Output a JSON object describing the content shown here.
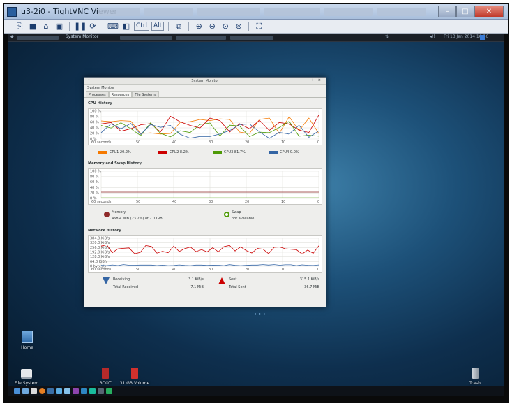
{
  "viewer": {
    "title": "u3-2i0 - TightVNC Viewer",
    "toolbar_alt": "Alt",
    "toolbar_ctrl": "Ctrl"
  },
  "remote": {
    "taskbar_window": "System Monitor",
    "clock": "Fri 13 Jan 2014 16:36"
  },
  "monitor": {
    "window_title": "System Monitor",
    "menu_label": "System Monitor",
    "tabs": [
      "Processes",
      "Resources",
      "File Systems"
    ],
    "active_tab": "Resources",
    "cpu": {
      "title": "CPU History",
      "y_labels": [
        "100 %",
        "80 %",
        "60 %",
        "40 %",
        "20 %",
        "0 %"
      ],
      "x_labels": [
        "60 seconds",
        "50",
        "40",
        "30",
        "20",
        "10",
        "0"
      ],
      "legend": [
        {
          "label": "CPU1 20.2%",
          "color": "#f57900"
        },
        {
          "label": "CPU2 8.2%",
          "color": "#cc0000"
        },
        {
          "label": "CPU3 81.7%",
          "color": "#4e9a06"
        },
        {
          "label": "CPU4 0.0%",
          "color": "#3465a4"
        }
      ]
    },
    "mem": {
      "title": "Memory and Swap History",
      "y_labels": [
        "100 %",
        "80 %",
        "60 %",
        "40 %",
        "20 %",
        "0 %"
      ],
      "x_labels": [
        "60 seconds",
        "50",
        "40",
        "30",
        "20",
        "10",
        "0"
      ],
      "memory_label": "Memory",
      "memory_value": "468.4 MiB (23.2%) of 2.0 GiB",
      "swap_label": "Swap",
      "swap_value": "not available",
      "memory_color": "#8f2a2a",
      "swap_color": "#4e9a06"
    },
    "net": {
      "title": "Network History",
      "y_labels": [
        "384.0 KiB/s",
        "320.0 KiB/s",
        "256.0 KiB/s",
        "192.0 KiB/s",
        "128.0 KiB/s",
        "64.0 KiB/s",
        "0 bytes/s"
      ],
      "x_labels": [
        "60 seconds",
        "50",
        "40",
        "30",
        "20",
        "10",
        "0"
      ],
      "receiving_label": "Receiving",
      "receiving_value": "3.1 KiB/s",
      "total_received_label": "Total Received",
      "total_received_value": "7.1 MiB",
      "sent_label": "Sent",
      "sent_value": "315.1 KiB/s",
      "total_sent_label": "Total Sent",
      "total_sent_value": "36.7 MiB"
    }
  },
  "desktop": {
    "icons": [
      {
        "label": "Home"
      },
      {
        "label": "File System"
      },
      {
        "label": "BOOT"
      },
      {
        "label": "31 GB Volume"
      },
      {
        "label": "Trash"
      }
    ]
  }
}
